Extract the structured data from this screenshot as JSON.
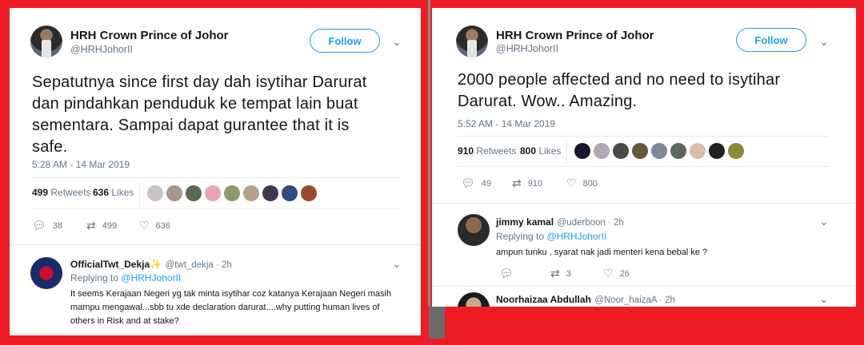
{
  "left": {
    "author": {
      "name": "HRH Crown Prince of Johor",
      "handle": "@HRHJohorII"
    },
    "follow_label": "Follow",
    "tweet_lines": [
      "Sepatutnya since first day dah isytihar Darurat",
      "dan pindahkan penduduk ke tempat lain buat",
      "sementara. Sampai dapat gurantee that it is",
      "safe."
    ],
    "timestamp": "5:28 AM - 14 Mar 2019",
    "retweets_count": "499",
    "retweets_label": "Retweets",
    "likes_count": "636",
    "likes_label": "Likes",
    "avatar_colors": [
      "#c9c4bf",
      "#a9938a",
      "#5c6a4f",
      "#e8a7b0",
      "#8c9a6b",
      "#b7a18a",
      "#3f3a4d",
      "#2f4d7a",
      "#9a4a2e"
    ],
    "actions": {
      "replies": "38",
      "retweets": "499",
      "likes": "636"
    },
    "reply": {
      "name": "OfficialTwt_Dekja",
      "badge": "✨",
      "handle": "@twt_dekja · 2h",
      "replying_label": "Replying to",
      "replying_handle": "@HRHJohorII",
      "text_lines": [
        "It seems Kerajaan Negeri yg tak minta isytihar coz katanya Kerajaan Negeri masih",
        "mampu mengawal...sbb tu xde declaration darurat....why putting human lives of",
        "others in Risk and at stake?"
      ]
    }
  },
  "right": {
    "author": {
      "name": "HRH Crown Prince of Johor",
      "handle": "@HRHJohorII"
    },
    "follow_label": "Follow",
    "tweet_lines": [
      "2000 people affected and no need to isytihar",
      "Darurat. Wow.. Amazing."
    ],
    "timestamp": "5:52 AM - 14 Mar 2019",
    "retweets_count": "910",
    "retweets_label": "Retweets",
    "likes_count": "800",
    "likes_label": "Likes",
    "avatar_colors": [
      "#1a1a2e",
      "#b0a6b8",
      "#4a4a4a",
      "#6b5a3a",
      "#7a8a9a",
      "#5a6a5a",
      "#d8c0a8",
      "#1f1f1f",
      "#8a8a3a"
    ],
    "actions": {
      "replies": "49",
      "retweets": "910",
      "likes": "800"
    },
    "reply1": {
      "name": "jimmy kamal",
      "handle": "@uderboon · 2h",
      "replying_label": "Replying to",
      "replying_handle": "@HRHJohorII",
      "text": "ampun tunku , syarat nak jadi menteri kena bebal ke ?",
      "actions": {
        "replies": "",
        "retweets": "3",
        "likes": "26"
      }
    },
    "reply2": {
      "name": "Noorhaizaa Abdullah",
      "handle": "@Noor_haizaA · 2h"
    }
  }
}
